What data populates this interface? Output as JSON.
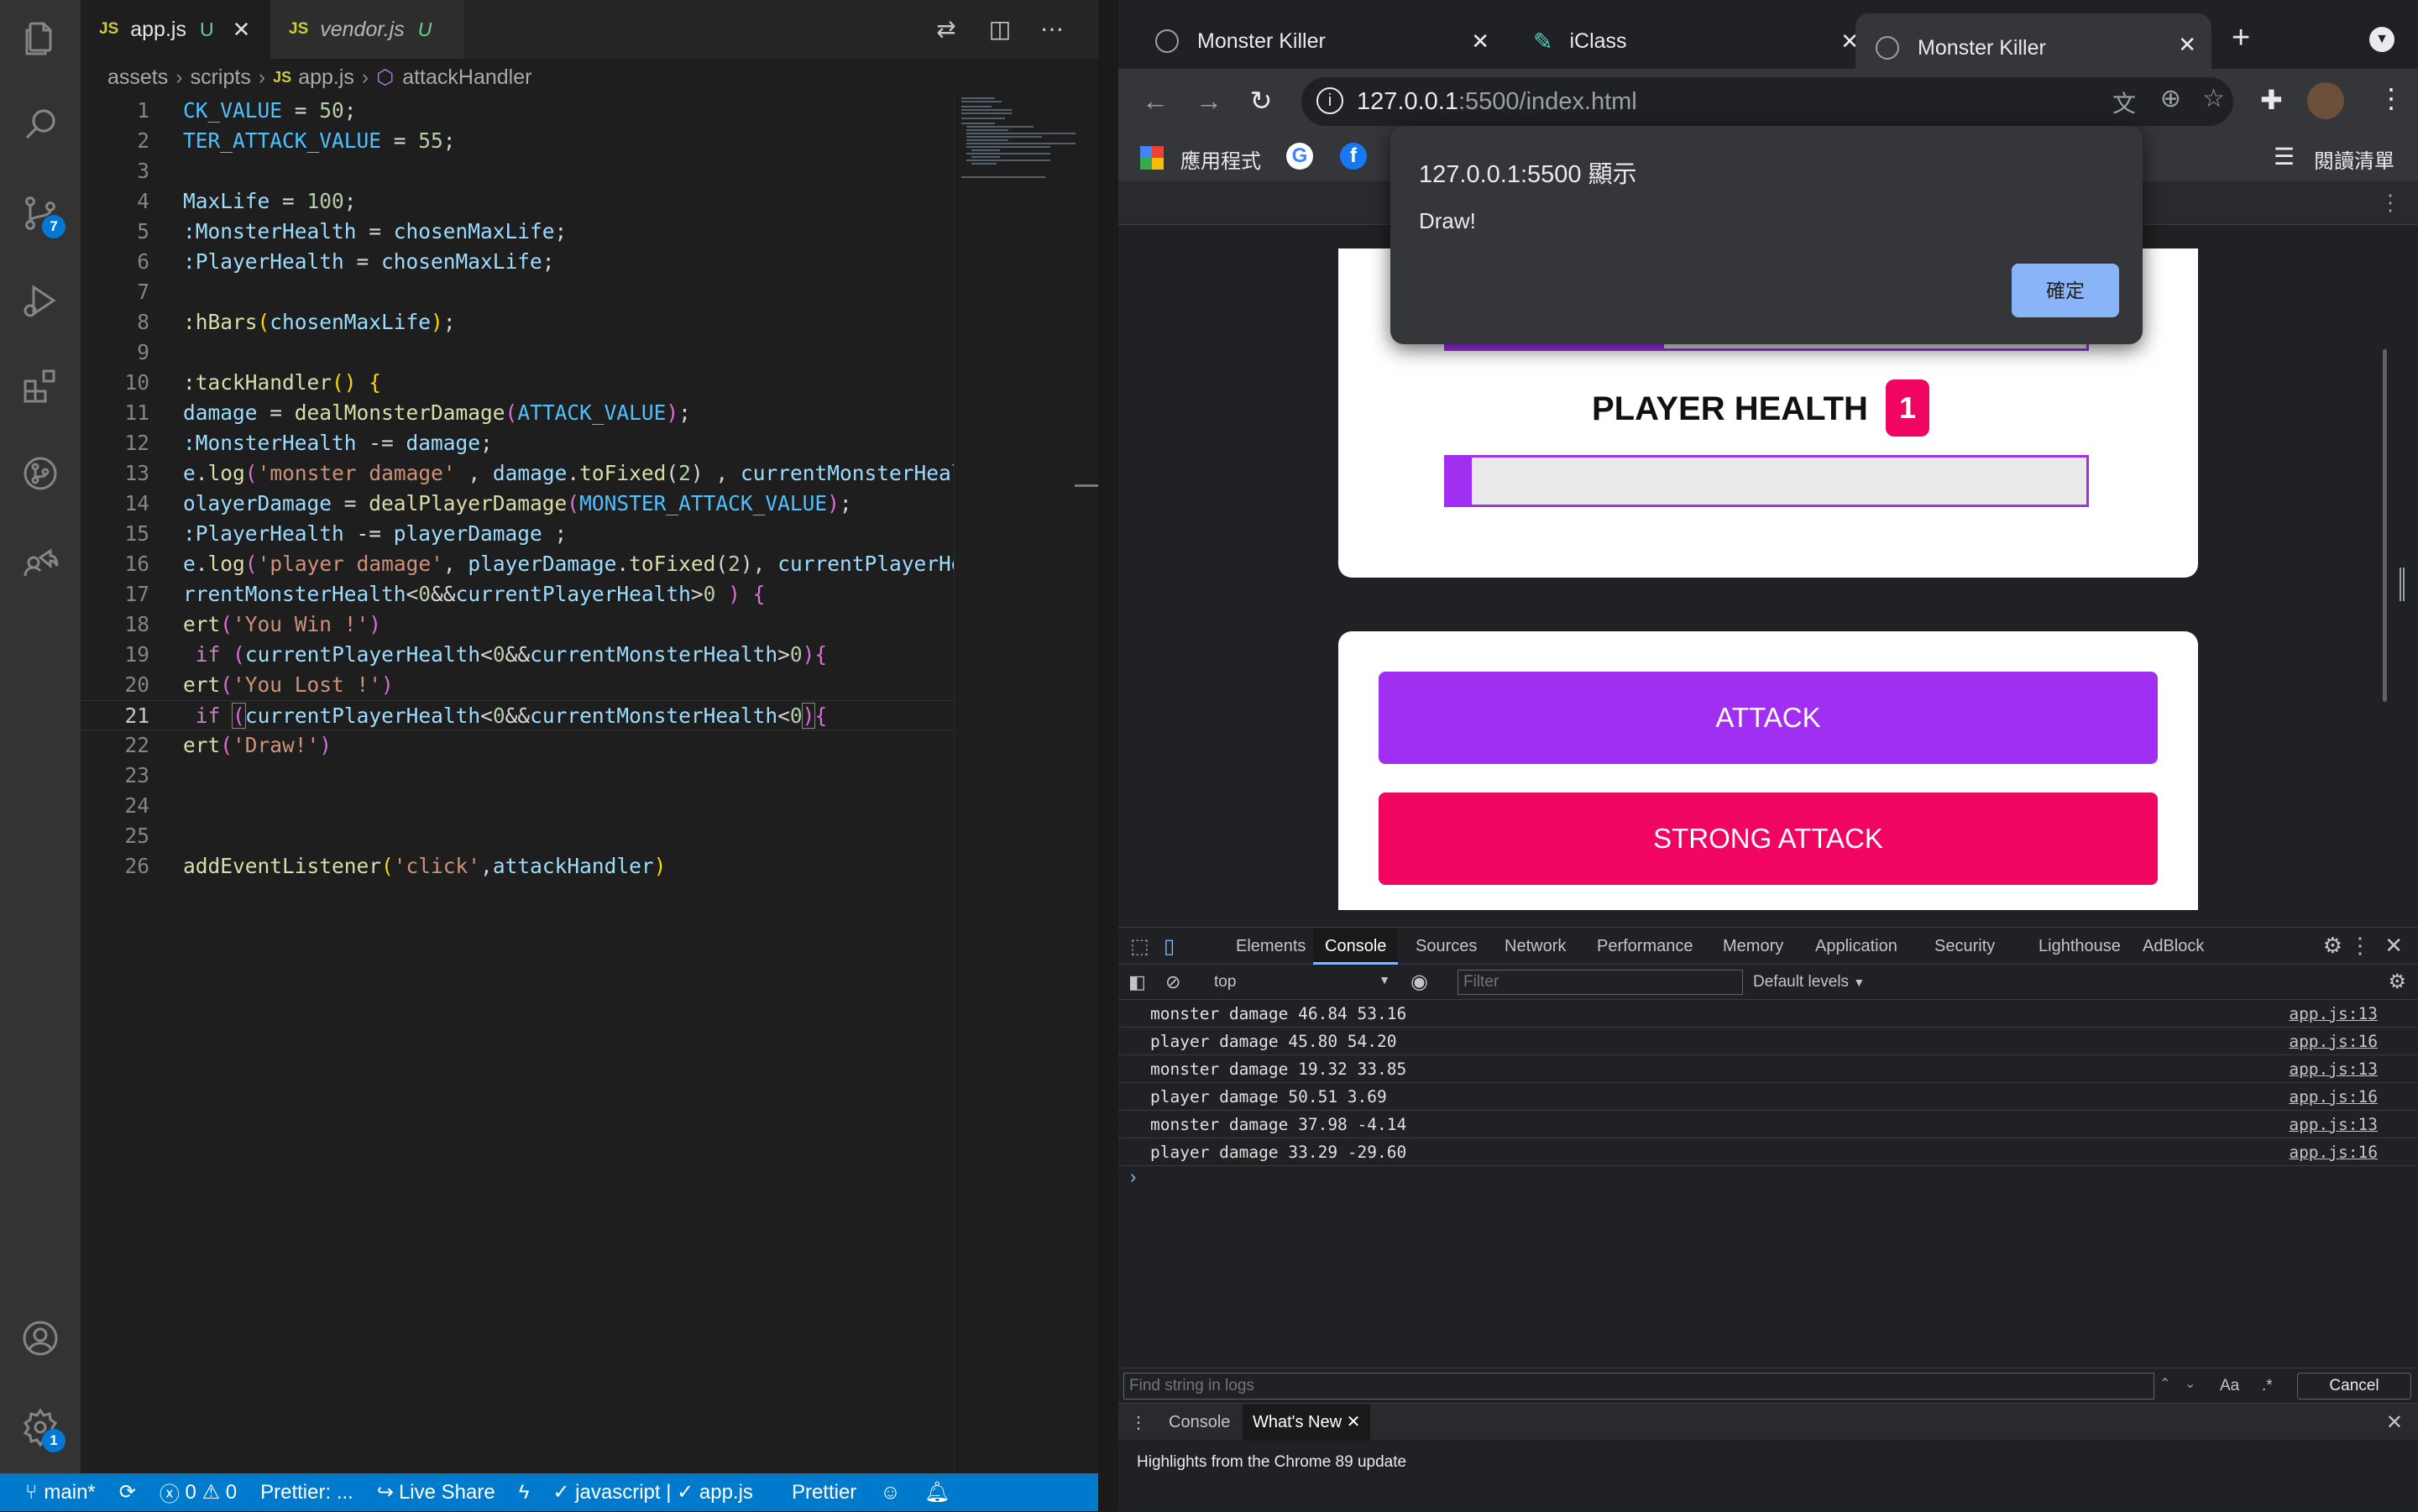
{
  "vscode": {
    "tabs": [
      {
        "label": "app.js",
        "status": "U",
        "active": true
      },
      {
        "label": "vendor.js",
        "status": "U",
        "active": false
      }
    ],
    "file_icon_label": "JS",
    "breadcrumb": [
      "assets",
      "scripts",
      "app.js",
      "attackHandler"
    ],
    "activity_badges": {
      "source_control": "7",
      "settings": "1"
    },
    "code_lines": [
      "1",
      "2",
      "3",
      "4",
      "5",
      "6",
      "7",
      "8",
      "9",
      "10",
      "11",
      "12",
      "13",
      "14",
      "15",
      "16",
      "17",
      "18",
      "19",
      "20",
      "21",
      "22",
      "23",
      "24",
      "25",
      "26"
    ],
    "current_line": "21",
    "status": {
      "branch": "main*",
      "errors": "0",
      "warnings": "0",
      "prettier_short": "Prettier: ...",
      "live_share": "Live Share",
      "language": "javascript | ✓ app.js",
      "prettier": "Prettier"
    }
  },
  "chrome": {
    "tabs": [
      {
        "title": "Monster Killer",
        "active": false
      },
      {
        "title": "iClass",
        "active": false
      },
      {
        "title": "Monster Killer",
        "active": true
      }
    ],
    "url_host": "127.0.0.1",
    "url_rest": ":5500/index.html",
    "bookmarks": {
      "apps": "應用程式",
      "reading_list": "閱讀清單"
    },
    "alert": {
      "origin": "127.0.0.1:5500 顯示",
      "message": "Draw!",
      "ok": "確定"
    },
    "page": {
      "player_health_label": "PLAYER HEALTH",
      "player_health_badge": "1",
      "monster_health_fill": 0.34,
      "player_health_fill": 0.04,
      "attack": "ATTACK",
      "strong_attack": "STRONG ATTACK",
      "colors": {
        "accent": "#a02ff2",
        "danger": "#f00560"
      }
    },
    "devtools": {
      "tabs": [
        "Elements",
        "Console",
        "Sources",
        "Network",
        "Performance",
        "Memory",
        "Application",
        "Security",
        "Lighthouse",
        "AdBlock"
      ],
      "active_tab": "Console",
      "context": "top",
      "filter_placeholder": "Filter",
      "levels": "Default levels",
      "logs": [
        {
          "msg": "monster damage 46.84 53.16",
          "src": "app.js:13"
        },
        {
          "msg": "player damage 45.80 54.20",
          "src": "app.js:16"
        },
        {
          "msg": "monster damage 19.32 33.85",
          "src": "app.js:13"
        },
        {
          "msg": "player damage 50.51 3.69",
          "src": "app.js:16"
        },
        {
          "msg": "monster damage 37.98 -4.14",
          "src": "app.js:13"
        },
        {
          "msg": "player damage 33.29 -29.60",
          "src": "app.js:16"
        }
      ],
      "find_placeholder": "Find string in logs",
      "find_case": "Aa",
      "find_regex": ".*",
      "find_cancel": "Cancel",
      "drawer_tabs": [
        "Console",
        "What's New"
      ],
      "drawer_text": "Highlights from the Chrome 89 update"
    }
  }
}
